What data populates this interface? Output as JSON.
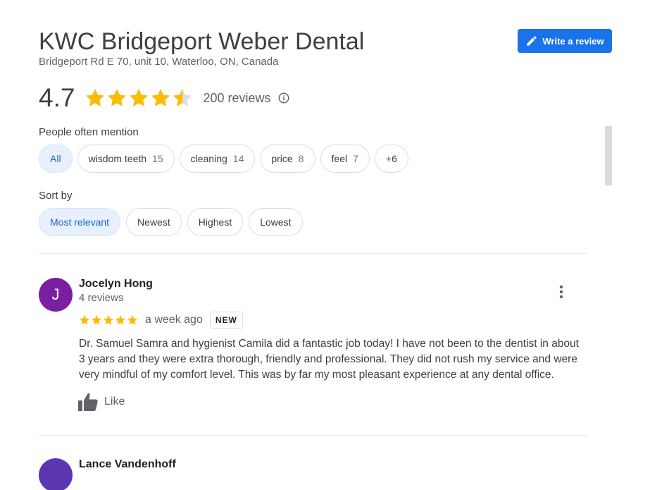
{
  "business": {
    "name": "KWC Bridgeport Weber Dental",
    "address": "Bridgeport Rd E 70, unit 10, Waterloo, ON, Canada"
  },
  "actions": {
    "write_review_label": "Write a review",
    "write_review_icon": "pencil-icon"
  },
  "rating": {
    "value": "4.7",
    "stars": 4.7,
    "reviews_label": "200 reviews",
    "info_icon": "info-icon"
  },
  "mentions": {
    "label": "People often mention",
    "chips": [
      {
        "label": "All",
        "count": ""
      },
      {
        "label": "wisdom teeth",
        "count": "15"
      },
      {
        "label": "cleaning",
        "count": "14"
      },
      {
        "label": "price",
        "count": "8"
      },
      {
        "label": "feel",
        "count": "7"
      },
      {
        "label": "+6",
        "count": ""
      }
    ],
    "selected": "All"
  },
  "sort": {
    "label": "Sort by",
    "options": [
      "Most relevant",
      "Newest",
      "Highest",
      "Lowest"
    ],
    "selected": "Most relevant"
  },
  "reviews": [
    {
      "initial": "J",
      "avatar_color": "#7b1fa2",
      "name": "Jocelyn Hong",
      "meta": "4 reviews",
      "stars": 5,
      "time": "a week ago",
      "badge": "NEW",
      "text": "Dr. Samuel Samra and hygienist Camila did a fantastic job today! I have not been to the dentist in about 3 years and they were extra thorough, friendly and professional. They did not rush my service and were very mindful of my comfort level. This was by far my most pleasant experience at any dental office.",
      "like_label": "Like"
    },
    {
      "initial": "",
      "avatar_color": "#5e35b1",
      "name": "Lance Vandenhoff"
    }
  ],
  "colors": {
    "star": "#fbbc04",
    "star_empty": "#dadce0",
    "accent": "#1a73e8",
    "chip_selected_bg": "#e8f0fe",
    "chip_selected_text": "#1967d2"
  }
}
